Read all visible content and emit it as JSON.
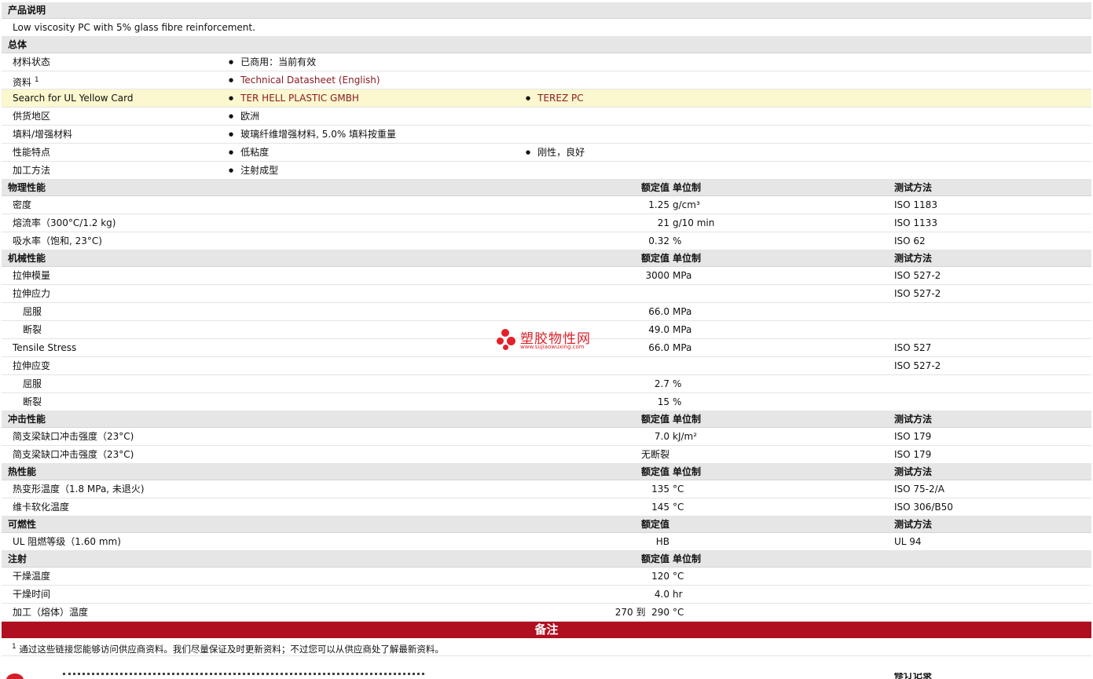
{
  "desc": {
    "header": "产品说明",
    "text": "Low viscosity PC with 5% glass fibre reinforcement."
  },
  "general": {
    "header": "总体",
    "status_label": "材料状态",
    "status_value": "已商用：当前有效",
    "doc_label": "资料",
    "doc_sup": "1",
    "doc_link": "Technical Datasheet (English)",
    "ul_label": "Search for UL Yellow Card",
    "ul_link1": "TER HELL PLASTIC GMBH",
    "ul_link2": "TEREZ PC",
    "region_label": "供货地区",
    "region_value": "欧洲",
    "filler_label": "填料/增强材料",
    "filler_value": "玻璃纤维增强材料, 5.0% 填料按重量",
    "feature_label": "性能特点",
    "feature_1": "低粘度",
    "feature_2": "刚性，良好",
    "process_label": "加工方法",
    "process_value": "注射成型"
  },
  "cols": {
    "nominal": "额定值",
    "unit": "单位制",
    "test": "测试方法"
  },
  "physical": {
    "header": "物理性能",
    "rows": [
      {
        "name": "密度",
        "val": "1.25",
        "unit": "g/cm³",
        "test": "ISO 1183"
      },
      {
        "name": "熔流率（300°C/1.2 kg)",
        "val": "21",
        "unit": "g/10 min",
        "test": "ISO 1133"
      },
      {
        "name": "吸水率（饱和, 23°C)",
        "val": "0.32",
        "unit": "%",
        "test": "ISO 62"
      }
    ]
  },
  "mechanical": {
    "header": "机械性能",
    "rows": [
      {
        "name": "拉伸模量",
        "val": "3000",
        "unit": "MPa",
        "test": "ISO 527-2"
      },
      {
        "name": "拉伸应力",
        "val": "",
        "unit": "",
        "test": "ISO 527-2"
      },
      {
        "name": "屈服",
        "val": "66.0",
        "unit": "MPa",
        "test": ""
      },
      {
        "name": "断裂",
        "val": "49.0",
        "unit": "MPa",
        "test": ""
      },
      {
        "name": "Tensile Stress",
        "val": "66.0",
        "unit": "MPa",
        "test": "ISO 527"
      },
      {
        "name": "拉伸应变",
        "val": "",
        "unit": "",
        "test": "ISO 527-2"
      },
      {
        "name": "屈服",
        "val": "2.7",
        "unit": "%",
        "test": ""
      },
      {
        "name": "断裂",
        "val": "15",
        "unit": "%",
        "test": ""
      }
    ]
  },
  "impact": {
    "header": "冲击性能",
    "rows": [
      {
        "name": "简支梁缺口冲击强度（23°C)",
        "val": "7.0",
        "unit": "kJ/m²",
        "test": "ISO 179"
      },
      {
        "name": "简支梁缺口冲击强度（23°C)",
        "val": "无断裂",
        "unit": "",
        "test": "ISO 179"
      }
    ]
  },
  "thermal": {
    "header": "热性能",
    "rows": [
      {
        "name": "热变形温度（1.8 MPa, 未退火)",
        "val": "135",
        "unit": "°C",
        "test": "ISO 75-2/A"
      },
      {
        "name": "维卡软化温度",
        "val": "145",
        "unit": "°C",
        "test": "ISO 306/B50"
      }
    ]
  },
  "flame": {
    "header": "可燃性",
    "rows": [
      {
        "name": "UL 阻燃等级（1.60 mm)",
        "val": "HB",
        "test": "UL 94"
      }
    ]
  },
  "injection": {
    "header": "注射",
    "rows": [
      {
        "name": "干燥温度",
        "val": "120",
        "unit": "°C"
      },
      {
        "name": "干燥时间",
        "val": "4.0",
        "unit": "hr"
      },
      {
        "name": "加工（熔体）温度",
        "val": "270 到  290",
        "unit": "°C"
      }
    ]
  },
  "notes": {
    "header": "备注",
    "sup": "1",
    "text": "通过这些链接您能够访问供应商资料。我们尽量保证及时更新资料；不过您可以从供应商处了解最新资料。"
  },
  "watermark": {
    "title": "塑胶物性网",
    "url": "www.sujiaowuxing.com"
  },
  "footer": {
    "partial": "修订记录"
  }
}
